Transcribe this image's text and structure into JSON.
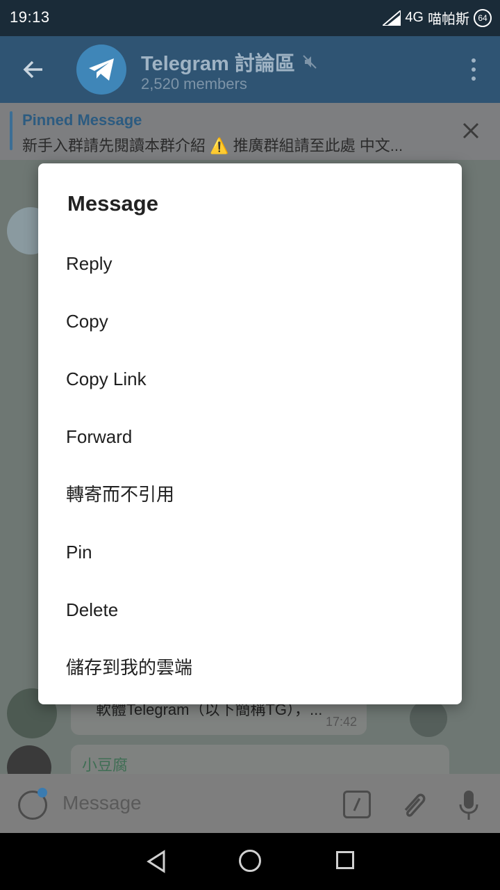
{
  "status_bar": {
    "time": "19:13",
    "network": "4G",
    "carrier": "喵帕斯",
    "battery": "64"
  },
  "header": {
    "title": "Telegram 討論區",
    "members": "2,520 members"
  },
  "pinned": {
    "title": "Pinned Message",
    "text": "新手入群請先閱讀本群介紹 ⚠️ 推廣群組請至此處 中文..."
  },
  "chat": {
    "bubble1_text": "軟體Telegram（以下簡稱TG），...",
    "bubble1_time": "17:42",
    "bubble2_sender": "小豆腐"
  },
  "composer": {
    "placeholder": "Message"
  },
  "dialog": {
    "title": "Message",
    "items": [
      "Reply",
      "Copy",
      "Copy Link",
      "Forward",
      "轉寄而不引用",
      "Pin",
      "Delete",
      "儲存到我的雲端"
    ]
  },
  "colors": {
    "header_bg": "#2f5473",
    "accent": "#3b6e95",
    "dialog_bg": "#ffffff"
  }
}
